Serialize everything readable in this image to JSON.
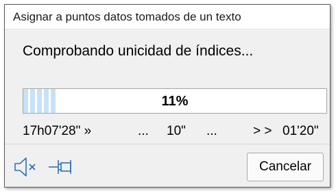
{
  "window": {
    "title": "Asignar a puntos datos tomados de un texto"
  },
  "status": {
    "message": "Comprobando unicidad de índices..."
  },
  "progress": {
    "value_percent": 11,
    "label": "11%",
    "fill_color": "#c6e2f6"
  },
  "timing": {
    "start": "17h07'28\" »",
    "sep1": "...",
    "elapsed": "10\"",
    "sep2": "...",
    "remaining_marker": "> >",
    "remaining": "01'20\""
  },
  "footer": {
    "mute_icon": "speaker-muted-icon",
    "pin_icon": "pin-icon",
    "icon_color": "#2f6fb5",
    "cancel_label": "Cancelar"
  }
}
